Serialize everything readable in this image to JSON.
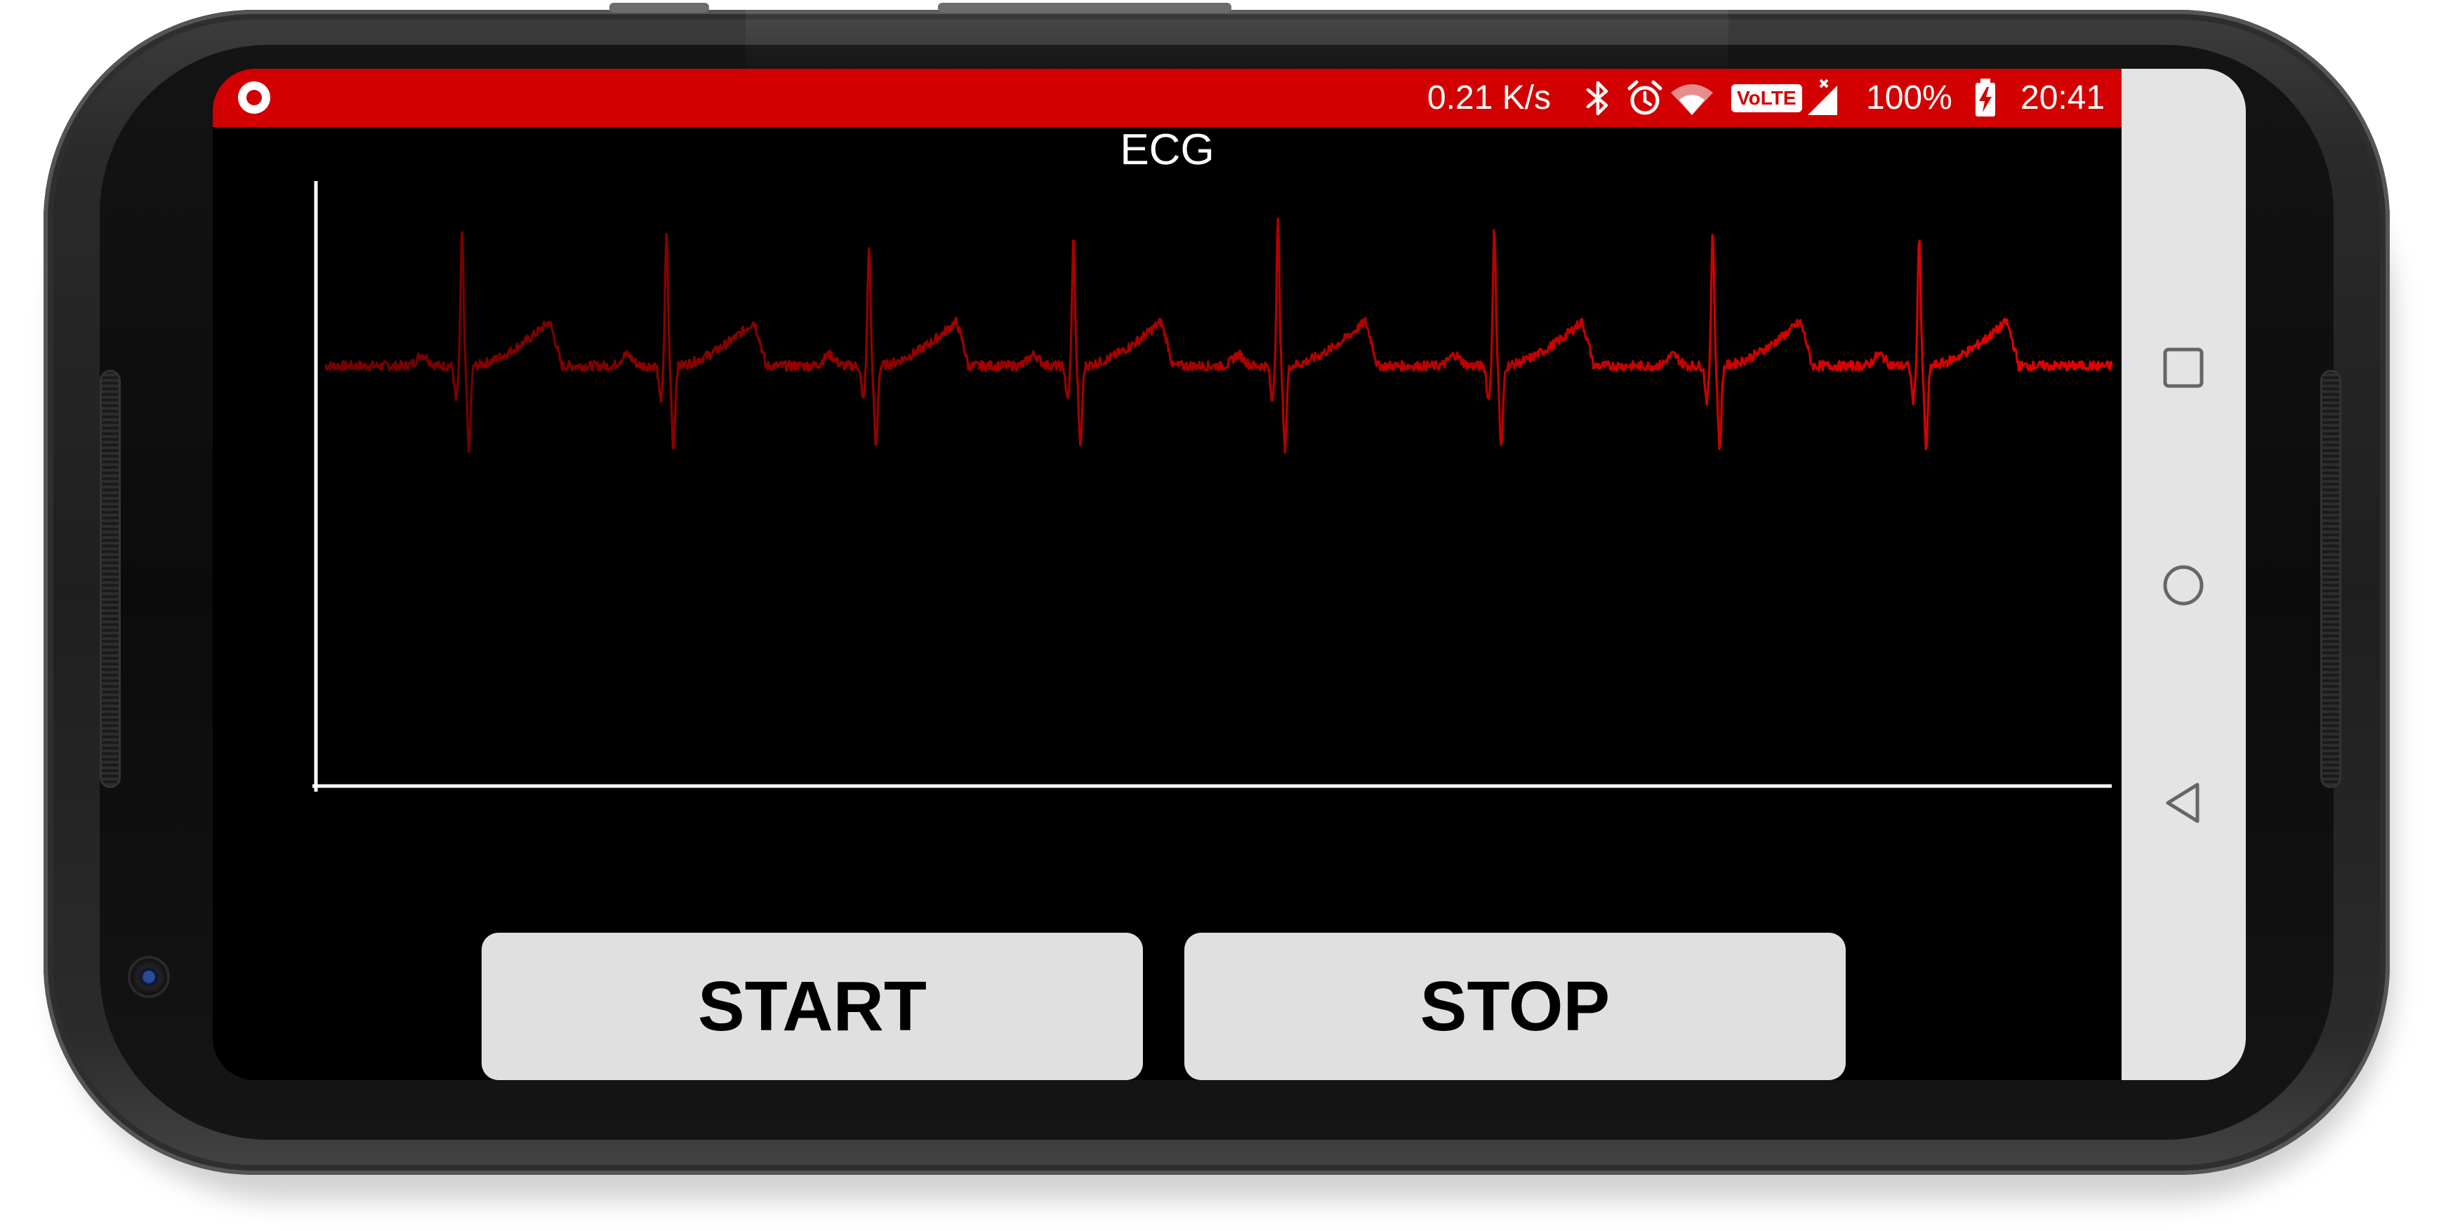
{
  "status_bar": {
    "left_icon": "screen-record-icon",
    "network_speed": "0.21 K/s",
    "icons": [
      "bluetooth-icon",
      "alarm-icon",
      "wifi-icon",
      "volte-badge",
      "cellular-signal-icon",
      "battery-charging-icon"
    ],
    "volte_label": "VoLTE",
    "battery": "100%",
    "time": "20:41",
    "background_color": "#d20000"
  },
  "navigation_bar": {
    "buttons": [
      "recents-square-icon",
      "home-circle-icon",
      "back-triangle-icon"
    ]
  },
  "chart_data": {
    "type": "line",
    "title": "ECG",
    "xlabel": "",
    "ylabel": "",
    "tick_labels": false,
    "grid": false,
    "legend": "none",
    "series_color": "#e00000",
    "background": "#000000",
    "axis_color": "#ffffff",
    "xlim": [
      0,
      9
    ],
    "ylim": [
      -3,
      1.5
    ],
    "beats": [
      {
        "r_x": 0.69,
        "r_y": 1.0
      },
      {
        "r_x": 1.72,
        "r_y": 0.97
      },
      {
        "r_x": 2.74,
        "r_y": 0.88
      },
      {
        "r_x": 3.77,
        "r_y": 0.93
      },
      {
        "r_x": 4.8,
        "r_y": 1.05
      },
      {
        "r_x": 5.89,
        "r_y": 1.0
      },
      {
        "r_x": 6.99,
        "r_y": 1.0
      },
      {
        "r_x": 8.03,
        "r_y": 0.95
      }
    ],
    "baseline_y": 0.0
  },
  "buttons": {
    "start": "START",
    "stop": "STOP"
  }
}
